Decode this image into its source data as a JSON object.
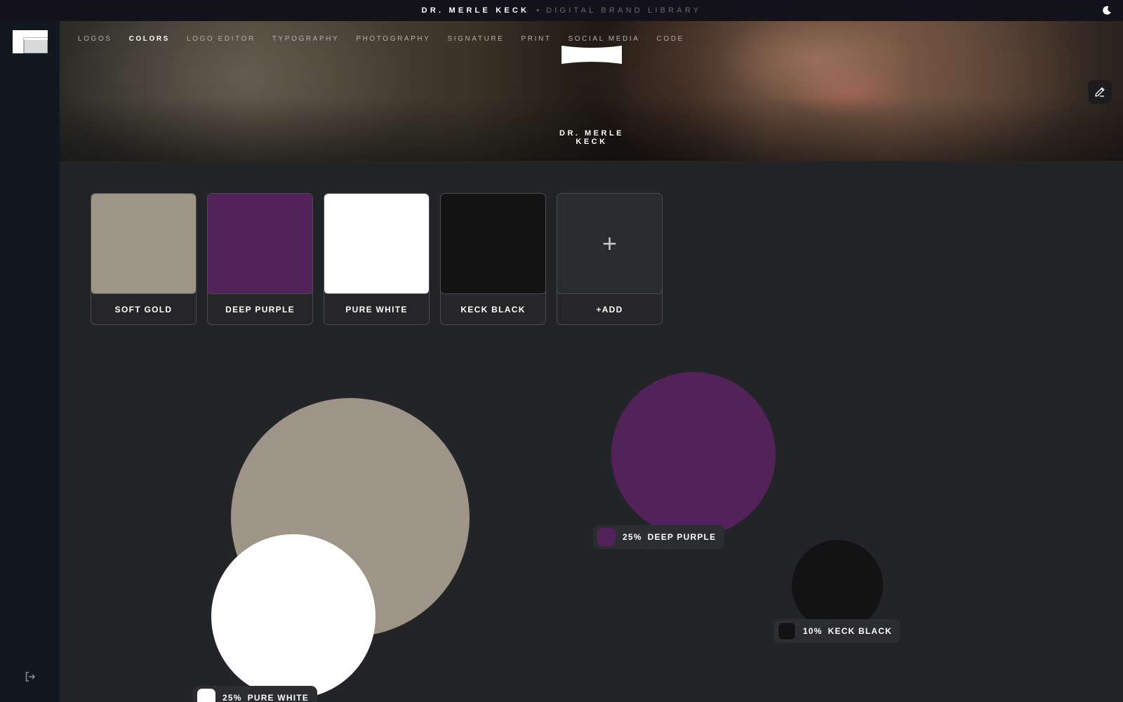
{
  "topbar": {
    "title": "DR. MERLE KECK",
    "separator": "•",
    "subtitle": "DIGITAL BRAND LIBRARY"
  },
  "nav": [
    {
      "label": "LOGOS",
      "active": false
    },
    {
      "label": "COLORS",
      "active": true
    },
    {
      "label": "LOGO EDITOR",
      "active": false
    },
    {
      "label": "TYPOGRAPHY",
      "active": false
    },
    {
      "label": "PHOTOGRAPHY",
      "active": false
    },
    {
      "label": "SIGNATURE",
      "active": false
    },
    {
      "label": "PRINT",
      "active": false
    },
    {
      "label": "SOCIAL MEDIA",
      "active": false
    },
    {
      "label": "CODE",
      "active": false
    }
  ],
  "hero": {
    "name": "DR. MERLE KECK"
  },
  "icons": {
    "theme": "moon-icon",
    "edit": "pencil-icon",
    "logout": "logout-icon",
    "add": "plus-icon"
  },
  "swatches": [
    {
      "name": "SOFT GOLD",
      "color": "#9e9487"
    },
    {
      "name": "DEEP PURPLE",
      "color": "#53225a"
    },
    {
      "name": "PURE WHITE",
      "color": "#ffffff"
    },
    {
      "name": "KECK BLACK",
      "color": "#131314"
    }
  ],
  "add_swatch": {
    "symbol": "+",
    "label": "+ADD"
  },
  "distribution": [
    {
      "name": "SOFT GOLD",
      "color": "#9e9487",
      "percent": "",
      "show_label": false
    },
    {
      "name": "PURE WHITE",
      "color": "#ffffff",
      "percent": "25%",
      "show_label": true
    },
    {
      "name": "DEEP PURPLE",
      "color": "#53225a",
      "percent": "25%",
      "show_label": true
    },
    {
      "name": "KECK BLACK",
      "color": "#131314",
      "percent": "10%",
      "show_label": true
    }
  ]
}
